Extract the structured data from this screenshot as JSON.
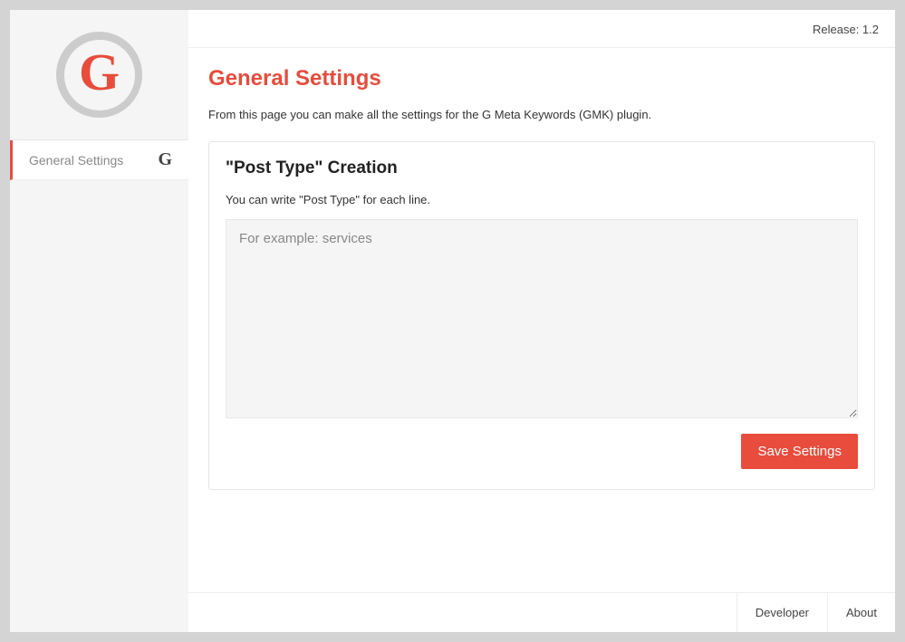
{
  "header": {
    "release_label": "Release: 1.2"
  },
  "sidebar": {
    "logo_letter": "G",
    "items": [
      {
        "label": "General Settings",
        "icon_letter": "G"
      }
    ]
  },
  "page": {
    "title": "General Settings",
    "description": "From this page you can make all the settings for the G Meta Keywords (GMK) plugin."
  },
  "post_type_panel": {
    "title": "\"Post Type\" Creation",
    "description": "You can write \"Post Type\" for each line.",
    "placeholder": "For example: services",
    "value": ""
  },
  "buttons": {
    "save": "Save Settings"
  },
  "footer": {
    "developer": "Developer",
    "about": "About"
  }
}
